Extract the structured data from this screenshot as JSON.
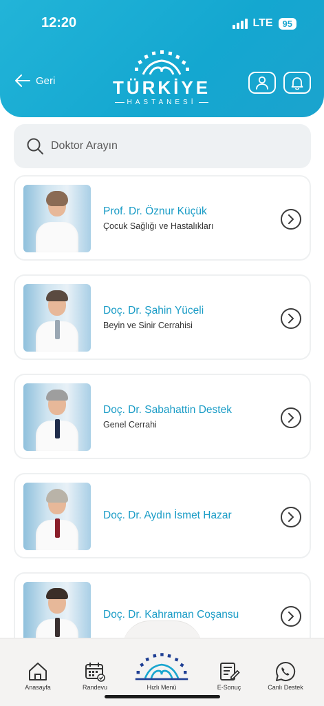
{
  "status_bar": {
    "time": "12:20",
    "network": "LTE",
    "battery": "95"
  },
  "header": {
    "back_label": "Geri",
    "logo_title": "TÜRKİYE",
    "logo_subtitle": "HASTANESİ",
    "profile_icon": "user-icon",
    "notification_icon": "bell-icon",
    "accent_color": "#1aa6cf"
  },
  "search": {
    "placeholder": "Doktor Arayın"
  },
  "doctors": [
    {
      "name": "Prof. Dr. Öznur Küçük",
      "specialty": "Çocuk Sağlığı ve Hastalıkları"
    },
    {
      "name": "Doç. Dr. Şahin Yüceli",
      "specialty": "Beyin ve Sinir Cerrahisi"
    },
    {
      "name": "Doç. Dr. Sabahattin Destek",
      "specialty": "Genel Cerrahi"
    },
    {
      "name": "Doç. Dr. Aydın İsmet Hazar",
      "specialty": ""
    },
    {
      "name": "Doç. Dr. Kahraman Coşansu",
      "specialty": ""
    }
  ],
  "bottom_nav": {
    "items": [
      {
        "label": "Anasayfa",
        "icon": "home-icon"
      },
      {
        "label": "Randevu",
        "icon": "calendar-icon"
      },
      {
        "label": "Hızlı Menü",
        "icon": "logo-icon"
      },
      {
        "label": "E-Sonuç",
        "icon": "document-edit-icon"
      },
      {
        "label": "Canlı Destek",
        "icon": "phone-chat-icon"
      }
    ]
  }
}
